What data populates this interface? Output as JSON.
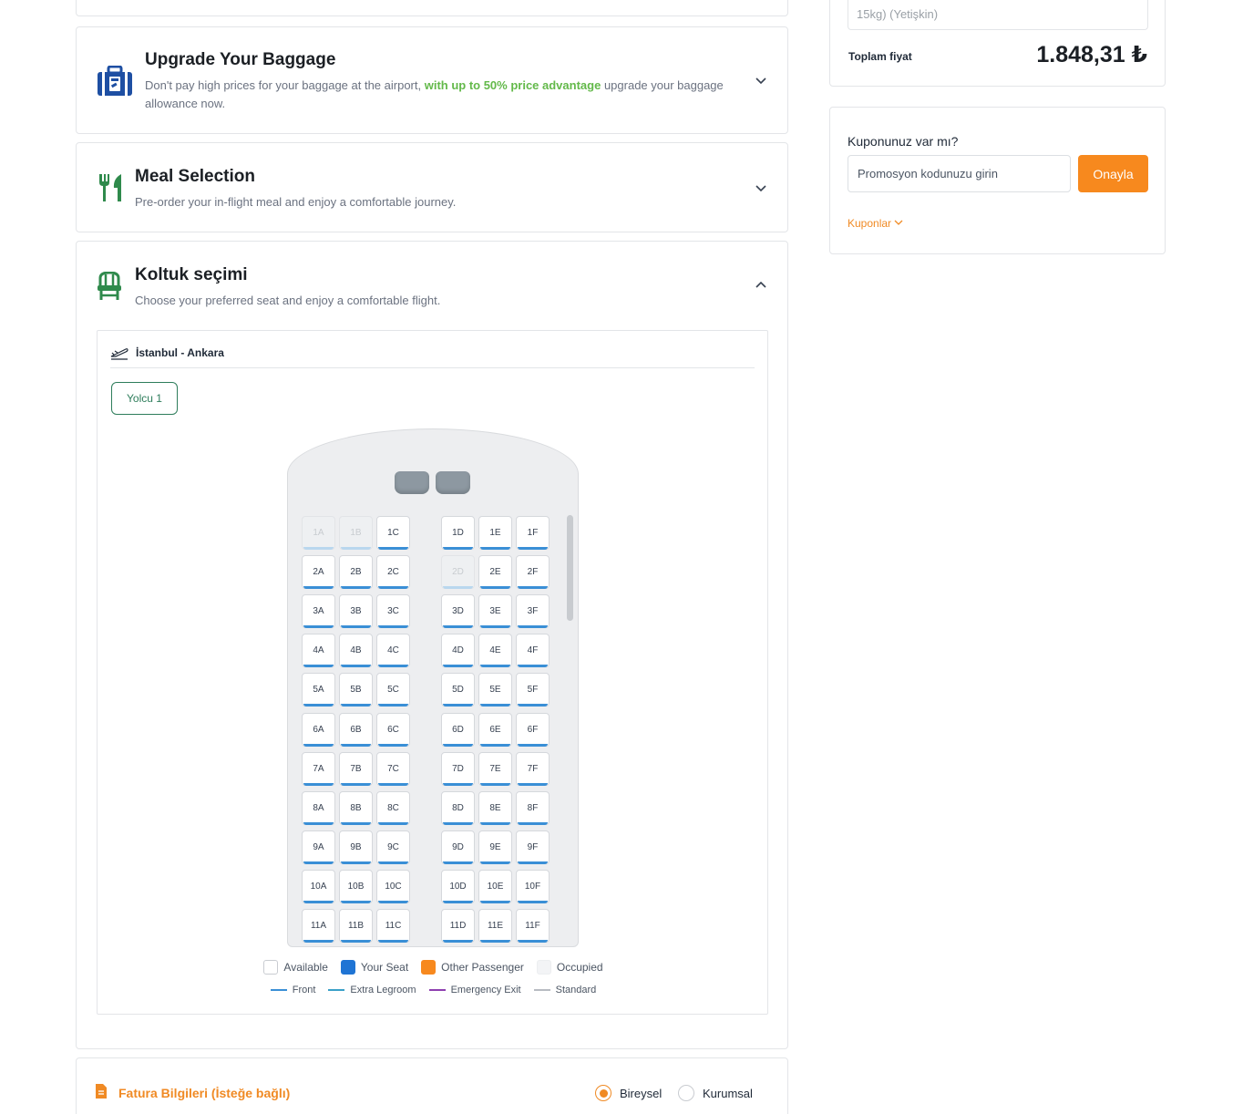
{
  "baggage": {
    "title": "Upgrade Your Baggage",
    "desc_pre": "Don't pay high prices for your baggage at the airport, ",
    "desc_highlight": "with up to 50% price advantage",
    "desc_post": " upgrade your baggage allowance now."
  },
  "meal": {
    "title": "Meal Selection",
    "desc": "Pre-order your in-flight meal and enjoy a comfortable journey."
  },
  "seat_selection": {
    "title": "Koltuk seçimi",
    "desc": "Choose your preferred seat and enjoy a comfortable flight.",
    "route": "İstanbul - Ankara",
    "passenger_tab": "Yolcu 1",
    "rows": [
      [
        "1A",
        "1B",
        "1C",
        "1D",
        "1E",
        "1F"
      ],
      [
        "2A",
        "2B",
        "2C",
        "2D",
        "2E",
        "2F"
      ],
      [
        "3A",
        "3B",
        "3C",
        "3D",
        "3E",
        "3F"
      ],
      [
        "4A",
        "4B",
        "4C",
        "4D",
        "4E",
        "4F"
      ],
      [
        "5A",
        "5B",
        "5C",
        "5D",
        "5E",
        "5F"
      ],
      [
        "6A",
        "6B",
        "6C",
        "6D",
        "6E",
        "6F"
      ],
      [
        "7A",
        "7B",
        "7C",
        "7D",
        "7E",
        "7F"
      ],
      [
        "8A",
        "8B",
        "8C",
        "8D",
        "8E",
        "8F"
      ],
      [
        "9A",
        "9B",
        "9C",
        "9D",
        "9E",
        "9F"
      ],
      [
        "10A",
        "10B",
        "10C",
        "10D",
        "10E",
        "10F"
      ],
      [
        "11A",
        "11B",
        "11C",
        "11D",
        "11E",
        "11F"
      ]
    ],
    "occupied": [
      "1A",
      "1B",
      "2D"
    ],
    "legend": {
      "available": "Available",
      "your_seat": "Your Seat",
      "other_passenger": "Other Passenger",
      "occupied": "Occupied",
      "front": "Front",
      "extra_legroom": "Extra Legroom",
      "emergency_exit": "Emergency Exit",
      "standard": "Standard"
    },
    "colors": {
      "front": "#3a8fd6",
      "extra_legroom": "#3aa0c8",
      "emergency_exit": "#8e3fb0",
      "standard": "#b8bcc2",
      "your_seat": "#1f74d4",
      "other_passenger": "#f7891e",
      "occupied": "#f3f4f6"
    }
  },
  "invoice": {
    "title": "Fatura Bilgileri (İsteğe bağlı)",
    "option_individual": "Bireysel",
    "option_corporate": "Kurumsal"
  },
  "price": {
    "passenger_line": "15kg) (Yetişkin)",
    "total_label": "Toplam fiyat",
    "total_value": "1.848,31 ₺"
  },
  "coupon": {
    "question": "Kuponunuz var mı?",
    "placeholder": "Promosyon kodunuzu girin",
    "confirm": "Onayla",
    "coupons_link": "Kuponlar"
  }
}
